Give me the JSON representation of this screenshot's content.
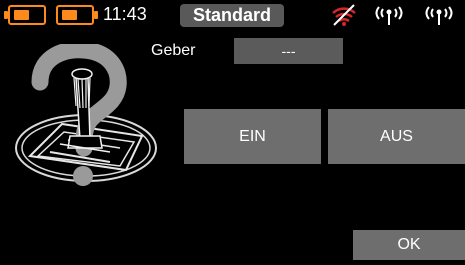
{
  "status_bar": {
    "battery_1_color": "#ff8a1c",
    "battery_2_color": "#ff8a1c",
    "time": "11:43",
    "profile": "Standard",
    "icons": [
      "signal-off-icon",
      "antenna-icon",
      "antenna-icon"
    ]
  },
  "transmitter": {
    "image": "stick-with-question-mark-icon"
  },
  "geber": {
    "label": "Geber",
    "value": "---"
  },
  "buttons": {
    "on_label": "EIN",
    "off_label": "AUS",
    "ok_label": "OK"
  },
  "colors": {
    "accent": "#ff8a1c",
    "signal_off": "#d4262b",
    "button_bg": "#6e6e6e",
    "field_bg": "#5b5b5b"
  }
}
